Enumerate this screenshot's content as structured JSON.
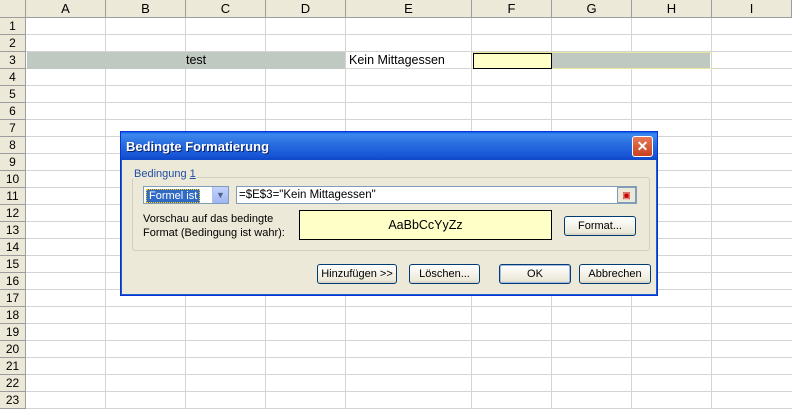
{
  "columns": [
    "A",
    "B",
    "C",
    "D",
    "E",
    "F",
    "G",
    "H",
    "I"
  ],
  "rows": [
    "1",
    "2",
    "3",
    "4",
    "5",
    "6",
    "7",
    "8",
    "9",
    "10",
    "11",
    "12",
    "13",
    "14",
    "15",
    "16",
    "17",
    "18",
    "19",
    "20",
    "21",
    "22",
    "23"
  ],
  "cells": {
    "B3": "test",
    "E3": "Kein Mittagessen"
  },
  "colors": {
    "row_band": "#bfc9c2",
    "cell_highlight": "#ffffc8",
    "titlebar": "#1654d6",
    "dialog_bg": "#ece9d8"
  },
  "dialog": {
    "title": "Bedingte Formatierung",
    "group_label_prefix": "Bedingung ",
    "group_label_number": "1",
    "condition_type": "Formel ist",
    "formula": "=$E$3=\"Kein Mittagessen\"",
    "preview_label_line1": "Vorschau auf das bedingte",
    "preview_label_line2": "Format (Bedingung ist wahr):",
    "preview_text": "AaBbCcYyZz",
    "format_button": "Format...",
    "add_button": "Hinzufügen >>",
    "delete_button": "Löschen...",
    "ok_button": "OK",
    "cancel_button": "Abbrechen"
  }
}
